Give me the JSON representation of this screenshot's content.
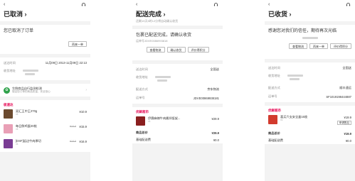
{
  "colors": {
    "accent": "#e5004f",
    "fresh_green": "#2fa24b"
  },
  "icons": {
    "service": "headset-icon",
    "back": "chevron-left-icon",
    "fresh": "leaf-icon",
    "chevron": "chevron-right-icon"
  },
  "panels": [
    {
      "title": "已取消",
      "status_card": {
        "text": "您已取消了订单",
        "button": "再来一单"
      },
      "fields": [
        {
          "label": "送达时间",
          "value": "11月09日 2013-11月09日 22:13"
        },
        {
          "label": "收货地址",
          "value": ""
        }
      ],
      "fresh": {
        "title": "生鲜商品自行监测检测",
        "sub": "保证您订单的商品质量，安全放心"
      },
      "shop": "极速达",
      "items": [
        {
          "name": "双汇王中王270g",
          "qty": "x1",
          "price": "¥10.9",
          "old": ""
        },
        {
          "name": "每日鲜鸡蛋20枚",
          "qty": "x1",
          "price": "¥15.9",
          "old": "¥16.9"
        },
        {
          "name": "[DSF]延边牛肉厚切",
          "qty": "x1",
          "price": "¥16.9",
          "old": "¥19.9"
        }
      ]
    },
    {
      "title": "配送完成",
      "subtitle": "还剩19天5时12分将自动确认收货",
      "status_card": {
        "text": "包裹已配送完成，请确认收货",
        "sub": "运单号JDVE0086993818",
        "buttons": [
          "查看物流",
          "确认收货",
          "评价得积分"
        ]
      },
      "fields": [
        {
          "label": "送达时间",
          "value": "全国送"
        },
        {
          "label": "收货地址",
          "value": ""
        },
        {
          "label": "配送方式",
          "value": "京东物流"
        },
        {
          "label": "运单号",
          "value": "JDVE00869938181"
        }
      ],
      "shop": "优鲜超市",
      "items": [
        {
          "name": "伊赛麻辣牛肉酱拌饭架...",
          "qty": "x1",
          "price": "¥29.9",
          "old": ""
        }
      ],
      "summary": [
        {
          "label": "商品总价",
          "value": "¥29.9"
        },
        {
          "label": "基础配送费",
          "value": "¥0.0"
        }
      ]
    },
    {
      "title": "已收货",
      "status_card": {
        "text": "感谢您对我们的信任，期待再次光临",
        "buttons": [
          "查看物流",
          "再来一单",
          "评价得积分"
        ]
      },
      "fields": [
        {
          "label": "送达时间",
          "value": "全国送"
        },
        {
          "label": "收货地址",
          "value": ""
        },
        {
          "label": "配送方式",
          "value": "顺丰速运"
        },
        {
          "label": "运单号",
          "value": "SF1019198444887"
        }
      ],
      "shop": "优鲜超市",
      "items": [
        {
          "name": "喜买六支安全盒16枚",
          "qty": "x1",
          "price": "¥19.9",
          "old": "",
          "button": "申请售后"
        }
      ],
      "summary": [
        {
          "label": "商品总价",
          "value": "¥19.9"
        },
        {
          "label": "基础配送费",
          "value": "¥0.0"
        }
      ]
    }
  ]
}
